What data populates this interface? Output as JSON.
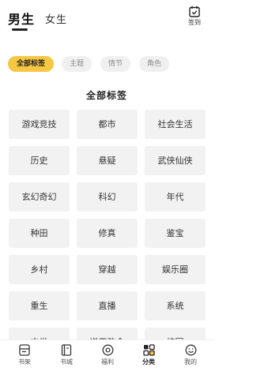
{
  "header": {
    "tabs": [
      {
        "label": "男生",
        "active": true
      },
      {
        "label": "女生",
        "active": false
      }
    ],
    "signin_label": "签到",
    "signin_icon": "calendar-check-icon"
  },
  "filters": [
    {
      "label": "全部标签",
      "active": true
    },
    {
      "label": "主题",
      "active": false
    },
    {
      "label": "情节",
      "active": false
    },
    {
      "label": "角色",
      "active": false
    }
  ],
  "section_title": "全部标签",
  "tags": [
    "游戏竞技",
    "都市",
    "社会生活",
    "历史",
    "悬疑",
    "武侠仙侠",
    "玄幻奇幻",
    "科幻",
    "年代",
    "种田",
    "修真",
    "鉴宝",
    "乡村",
    "穿越",
    "娱乐圈",
    "重生",
    "直播",
    "系统",
    "末世",
    "逆天改命",
    "校园"
  ],
  "bottom_nav": [
    {
      "label": "书架",
      "icon": "bookshelf-icon",
      "active": false
    },
    {
      "label": "书城",
      "icon": "book-icon",
      "active": false
    },
    {
      "label": "福利",
      "icon": "gift-icon",
      "active": false
    },
    {
      "label": "分类",
      "icon": "category-grid-icon",
      "active": true
    },
    {
      "label": "我的",
      "icon": "profile-face-icon",
      "active": false
    }
  ],
  "colors": {
    "accent": "#f7c744",
    "tag_bg": "#f2f2f2",
    "chip_bg": "#f0f0f0"
  }
}
